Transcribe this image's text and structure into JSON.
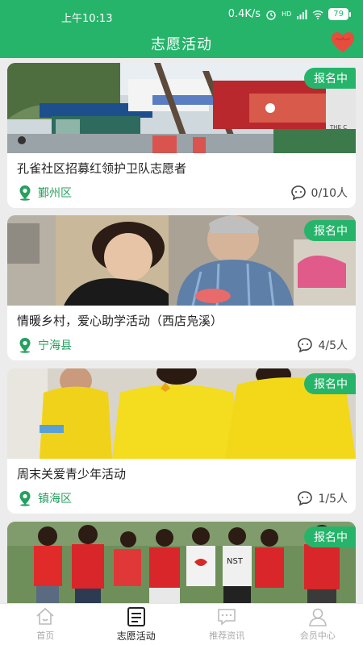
{
  "status_bar": {
    "time": "上午10:13",
    "network_speed": "0.4K/s",
    "network_type": "HD",
    "battery": "79"
  },
  "header": {
    "title": "志愿活动",
    "heart_icon": "heart-icon"
  },
  "activities": [
    {
      "title": "孔雀社区招募红领护卫队志愿者",
      "location": "鄞州区",
      "status": "报名中",
      "count": "0/10人",
      "sign_in_text": "THE C"
    },
    {
      "title": "情暖乡村，爱心助学活动（西店凫溪）",
      "location": "宁海县",
      "status": "报名中",
      "count": "4/5人"
    },
    {
      "title": "周末关爱青少年活动",
      "location": "镇海区",
      "status": "报名中",
      "count": "1/5人"
    },
    {
      "title": "",
      "location": "",
      "status": "报名中",
      "count": "",
      "shirt_text": "NST"
    }
  ],
  "tabs": [
    {
      "label": "首页",
      "icon": "home-icon"
    },
    {
      "label": "志愿活动",
      "icon": "activity-list-icon",
      "active": true
    },
    {
      "label": "推荐资讯",
      "icon": "chat-bubble-icon"
    },
    {
      "label": "会员中心",
      "icon": "user-icon"
    }
  ],
  "colors": {
    "brand_green": "#26b46a",
    "location_green": "#26a05e",
    "heart_red": "#e74c3c"
  }
}
